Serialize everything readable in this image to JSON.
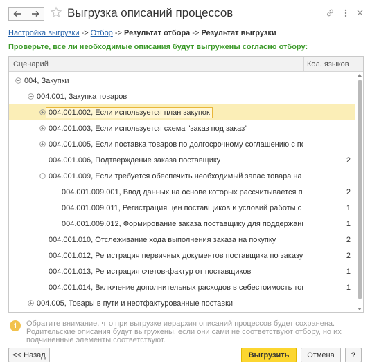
{
  "window": {
    "title": "Выгрузка описаний процессов"
  },
  "breadcrumb": {
    "step1": "Настройка выгрузки",
    "sep1": " -> ",
    "step2": "Отбор",
    "sep2": " -> ",
    "step3": "Результат отбора",
    "sep3": " -> ",
    "step4": "Результат выгрузки"
  },
  "prompt": "Проверьте, все ли необходимые описания будут выгружены согласно отбору:",
  "table": {
    "columns": [
      "Сценарий",
      "Кол. языков"
    ],
    "rows": [
      {
        "name": "004, Закупки",
        "count": "",
        "toggle": "minus",
        "level": 0
      },
      {
        "name": "004.001, Закупка товаров",
        "count": "",
        "toggle": "minus",
        "level": 1
      },
      {
        "name": "004.001.002, Если используется план закупок",
        "count": "",
        "toggle": "plus",
        "level": 2,
        "selected": true
      },
      {
        "name": "004.001.003, Если используется схема \"заказ под заказ\"",
        "count": "",
        "toggle": "plus",
        "level": 2
      },
      {
        "name": "004.001.005, Если поставка товаров по долгосрочному соглашению с по...",
        "count": "",
        "toggle": "plus",
        "level": 2
      },
      {
        "name": "004.001.006, Подтверждение заказа поставщику",
        "count": "2",
        "toggle": "none",
        "level": 2
      },
      {
        "name": "004.001.009, Если требуется обеспечить необходимый запас товара на с...",
        "count": "",
        "toggle": "minus",
        "level": 2
      },
      {
        "name": "004.001.009.001, Ввод данных на основе которых рассчитывается пот...",
        "count": "2",
        "toggle": "none",
        "level": 3
      },
      {
        "name": "004.001.009.011, Регистрация цен поставщиков и условий работы с ним",
        "count": "1",
        "toggle": "none",
        "level": 3
      },
      {
        "name": "004.001.009.012, Формирование заказа поставщику для поддержания...",
        "count": "1",
        "toggle": "none",
        "level": 3
      },
      {
        "name": "004.001.010, Отслеживание хода выполнения заказа на покупку",
        "count": "2",
        "toggle": "none",
        "level": 2
      },
      {
        "name": "004.001.012, Регистрация первичных документов поставщика по заказу ...",
        "count": "2",
        "toggle": "none",
        "level": 2
      },
      {
        "name": "004.001.013, Регистрация счетов-фактур от поставщиков",
        "count": "1",
        "toggle": "none",
        "level": 2
      },
      {
        "name": "004.001.014, Включение дополнительных расходов в себестоимость тов...",
        "count": "1",
        "toggle": "none",
        "level": 2
      },
      {
        "name": "004.005, Товары в пути и неотфактурованные поставки",
        "count": "",
        "toggle": "plus",
        "level": 1
      }
    ]
  },
  "note": {
    "icon": "info-icon",
    "text": "Обратите внимание, что при выгрузке иерархия описаний процессов будет сохранена. Родительские описания будут выгружены, если они сами не соответствуют отбору, но их подчиненные элементы соответствуют."
  },
  "buttons": {
    "back": "<< Назад",
    "unload": "Выгрузить",
    "cancel": "Отмена",
    "help": "?"
  },
  "colors": {
    "accent": "#fcd630",
    "link": "#1f5ea8",
    "prompt": "#3c9a2a",
    "selected_row": "#fbeeb7"
  }
}
